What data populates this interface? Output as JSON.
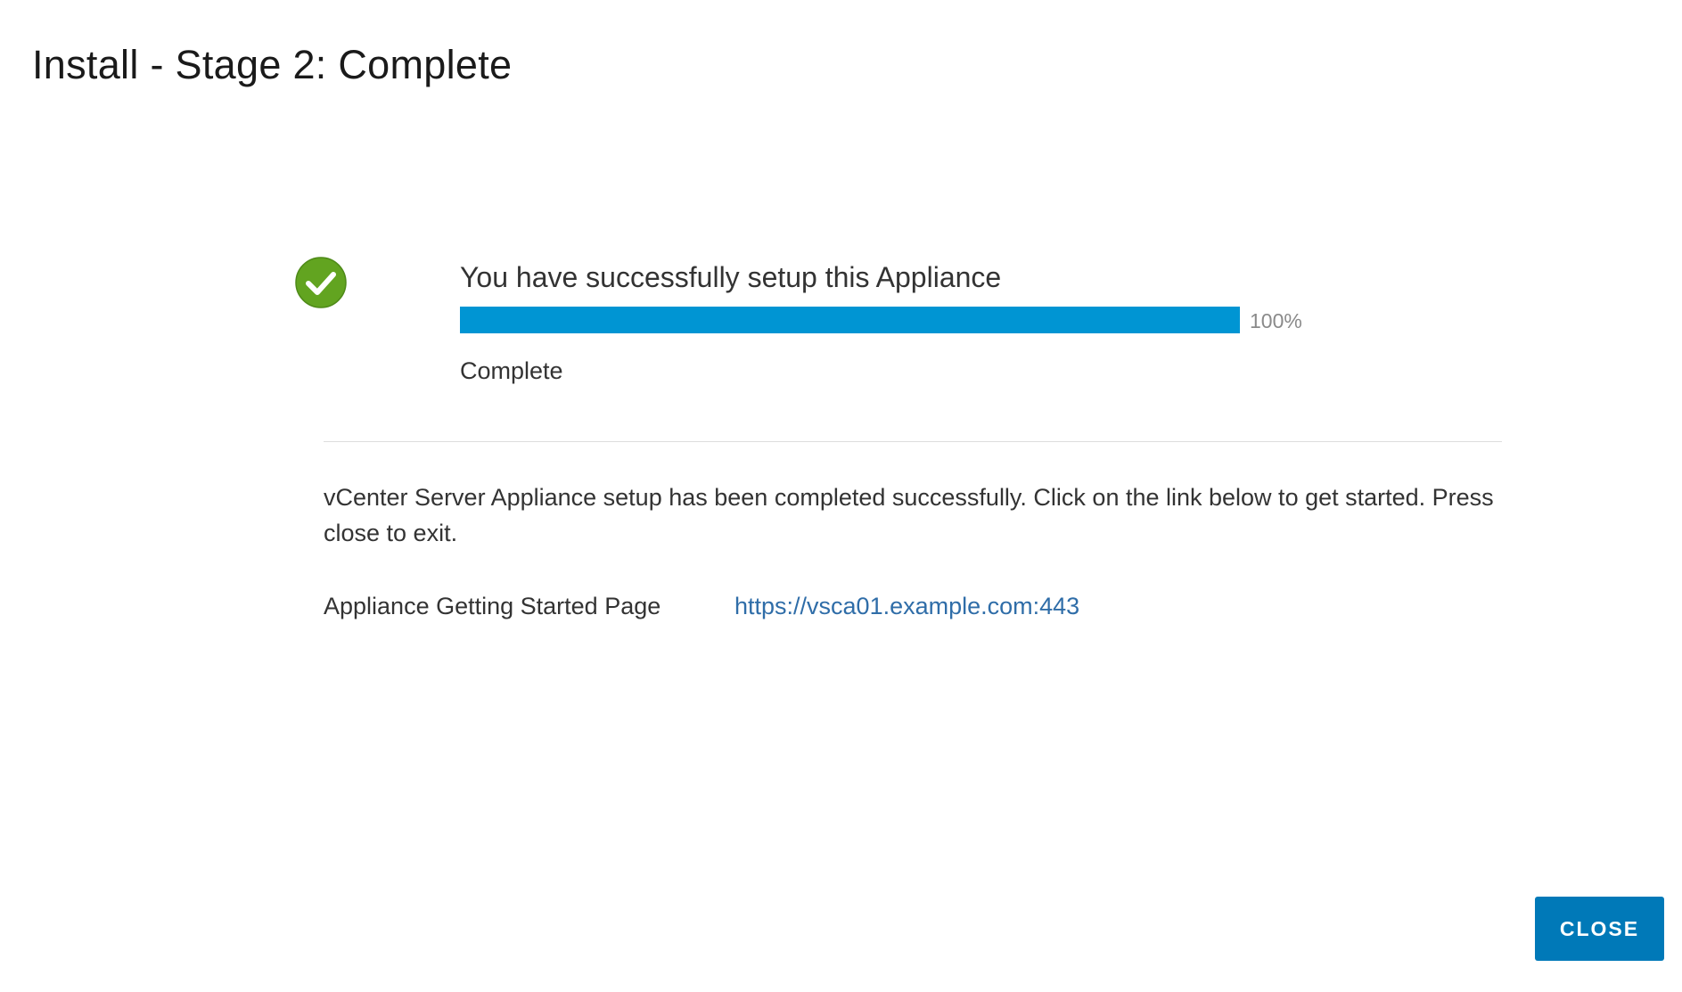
{
  "header": {
    "title": "Install - Stage 2: Complete"
  },
  "status": {
    "icon": "check-circle-icon",
    "heading": "You have successfully setup this Appliance",
    "progress_percent": 100,
    "progress_label": "100%",
    "state_text": "Complete"
  },
  "body": {
    "message": "vCenter Server Appliance setup has been completed successfully. Click on the link below to get started. Press close to exit.",
    "info": {
      "label": "Appliance Getting Started Page",
      "link_text": "https://vsca01.example.com:443"
    }
  },
  "footer": {
    "close_label": "CLOSE"
  },
  "colors": {
    "accent": "#0095d3",
    "button": "#0079b8",
    "success": "#62a420",
    "link": "#2f6da8"
  }
}
